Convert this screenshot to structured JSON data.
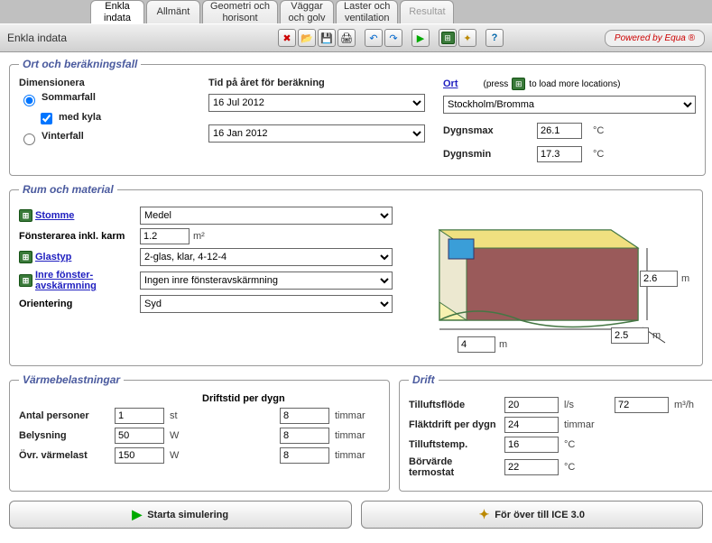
{
  "tabs": [
    {
      "label": "Enkla\nindata",
      "active": true
    },
    {
      "label": "Allmänt"
    },
    {
      "label": "Geometri och\nhorisont"
    },
    {
      "label": "Väggar\noch golv"
    },
    {
      "label": "Laster och\nventilation"
    },
    {
      "label": "Resultat",
      "disabled": true
    }
  ],
  "header": {
    "title": "Enkla indata",
    "powered": "Powered by Equa ®"
  },
  "ort": {
    "legend": "Ort och beräkningsfall",
    "dimensionera": "Dimensionera",
    "tid_label": "Tid på året för beräkning",
    "sommarfall": "Sommarfall",
    "med_kyla": "med kyla",
    "vinterfall": "Vinterfall",
    "date1": "16 Jul 2012",
    "date2": "16 Jan 2012",
    "ort_label": "Ort",
    "press_hint": "(press",
    "press_hint2": "to load more locations)",
    "location": "Stockholm/Bromma",
    "dygnsmax_lbl": "Dygnsmax",
    "dygnsmax": "26.1",
    "dygnsmin_lbl": "Dygnsmin",
    "dygnsmin": "17.3",
    "celsius": "°C"
  },
  "rum": {
    "legend": "Rum och material",
    "stomme_lbl": "Stomme",
    "stomme": "Medel",
    "fonster_lbl": "Fönsterarea inkl. karm",
    "fonster_val": "1.2",
    "fonster_unit": "m²",
    "glastyp_lbl": "Glastyp",
    "glastyp": "2-glas, klar, 4-12-4",
    "inre_lbl": "Inre fönster-\navskärmning",
    "inre": "Ingen inre fönsteravskärmning",
    "orient_lbl": "Orientering",
    "orient": "Syd",
    "length": "4",
    "width": "2.5",
    "height": "2.6",
    "m": "m"
  },
  "heat": {
    "legend": "Värmebelastningar",
    "drifts_hdr": "Driftstid per dygn",
    "antal_lbl": "Antal personer",
    "antal": "1",
    "st": "st",
    "antal_t": "8",
    "bel_lbl": "Belysning",
    "bel": "50",
    "w": "W",
    "bel_t": "8",
    "ovr_lbl": "Övr. värmelast",
    "ovr": "150",
    "ovr_t": "8",
    "timmar": "timmar"
  },
  "drift": {
    "legend": "Drift",
    "till_lbl": "Tilluftsflöde",
    "till": "20",
    "ls": "l/s",
    "till2": "72",
    "m3h": "m³/h",
    "flakt_lbl": "Fläktdrift per dygn",
    "flakt": "24",
    "timmar": "timmar",
    "temp_lbl": "Tilluftstemp.",
    "temp": "16",
    "c": "°C",
    "bor_lbl": "Börvärde termostat",
    "bor": "22"
  },
  "buttons": {
    "start": "Starta simulering",
    "ice": "För över till ICE 3.0"
  }
}
